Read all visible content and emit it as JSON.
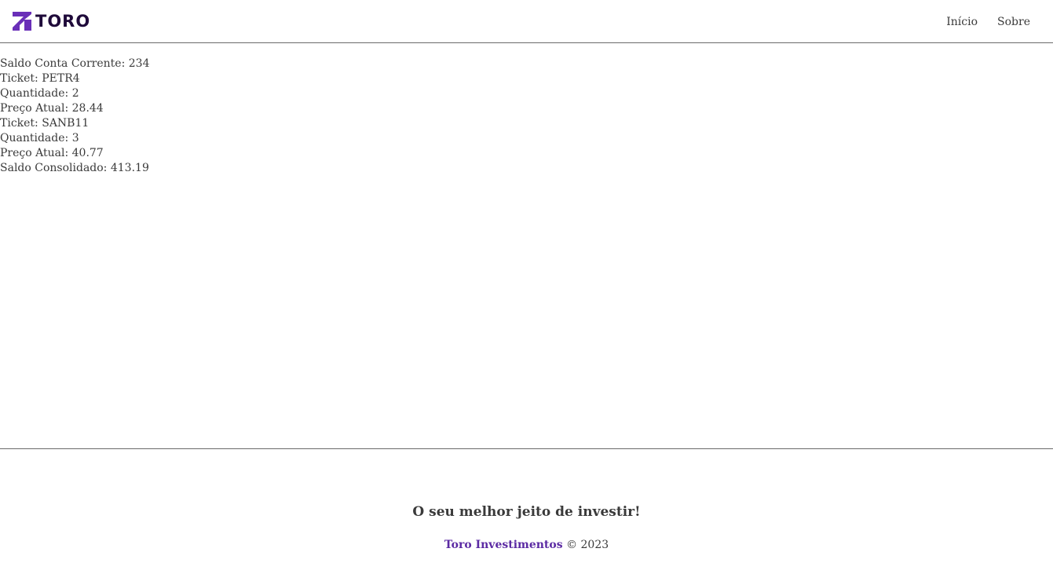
{
  "header": {
    "logo_text": "TORO",
    "logo_icon": "toro-logo-icon",
    "nav": [
      {
        "label": "Início"
      },
      {
        "label": "Sobre"
      }
    ]
  },
  "main": {
    "lines": [
      {
        "label": "Saldo Conta Corrente:",
        "value": "234"
      },
      {
        "label": "Ticket:",
        "value": "PETR4"
      },
      {
        "label": "Quantidade:",
        "value": "2"
      },
      {
        "label": "Preço Atual:",
        "value": "28.44"
      },
      {
        "label": "Ticket:",
        "value": "SANB11"
      },
      {
        "label": "Quantidade:",
        "value": "3"
      },
      {
        "label": "Preço Atual:",
        "value": "40.77"
      },
      {
        "label": "Saldo Consolidado:",
        "value": "413.19"
      }
    ]
  },
  "footer": {
    "slogan": "O seu melhor jeito de investir!",
    "brand": "Toro Investimentos",
    "copyright": "© 2023"
  },
  "colors": {
    "brand_purple": "#5b2aa3",
    "logo_dark": "#1f0a3a",
    "text": "#3a3a3a",
    "divider": "#6a6a6a"
  }
}
